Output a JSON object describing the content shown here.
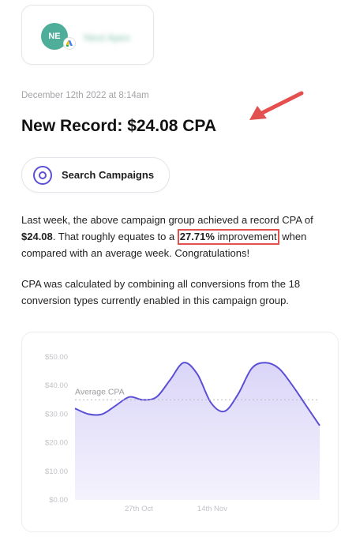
{
  "account": {
    "initials": "NE",
    "name": "Next Apex"
  },
  "timestamp": "December 12th 2022 at 8:14am",
  "headline": "New Record: $24.08 CPA",
  "button": {
    "label": "Search Campaigns"
  },
  "body": {
    "p1_part1": "Last week, the above campaign group achieved a record CPA of ",
    "p1_value": "$24.08",
    "p1_part2": ". That roughly equates to a ",
    "p1_highlight_pct": "27.71%",
    "p1_highlight_word": " improvement",
    "p1_part3": " when compared with an average week. Congratulations!",
    "p2": "CPA was calculated by combining all conversions from the 18 conversion types currently enabled in this campaign group."
  },
  "colors": {
    "accent": "#5b4fd6",
    "line": "#5b4fd6",
    "fill": "#ebe8fb",
    "annotation": "#e25050"
  },
  "chart_data": {
    "type": "area",
    "yticks": [
      "$50.00",
      "$40.00",
      "$30.00",
      "$20.00",
      "$10.00",
      "$0.00"
    ],
    "ylim": [
      0,
      50
    ],
    "xticks": [
      {
        "label": "27th Oct",
        "x": 4.7
      },
      {
        "label": "14th Nov",
        "x": 10.1
      }
    ],
    "xlim": [
      0,
      18
    ],
    "average": {
      "label": "Average CPA",
      "value": 35
    },
    "series": [
      {
        "x": [
          0,
          1,
          2,
          3,
          4,
          5,
          6,
          7,
          8,
          9,
          10,
          11,
          12,
          13,
          14,
          15,
          16,
          17,
          18
        ],
        "values": [
          32,
          30,
          30,
          33,
          36,
          35,
          36,
          42,
          48,
          44,
          34,
          31,
          37,
          46,
          48,
          46,
          40,
          33,
          26
        ]
      }
    ]
  }
}
